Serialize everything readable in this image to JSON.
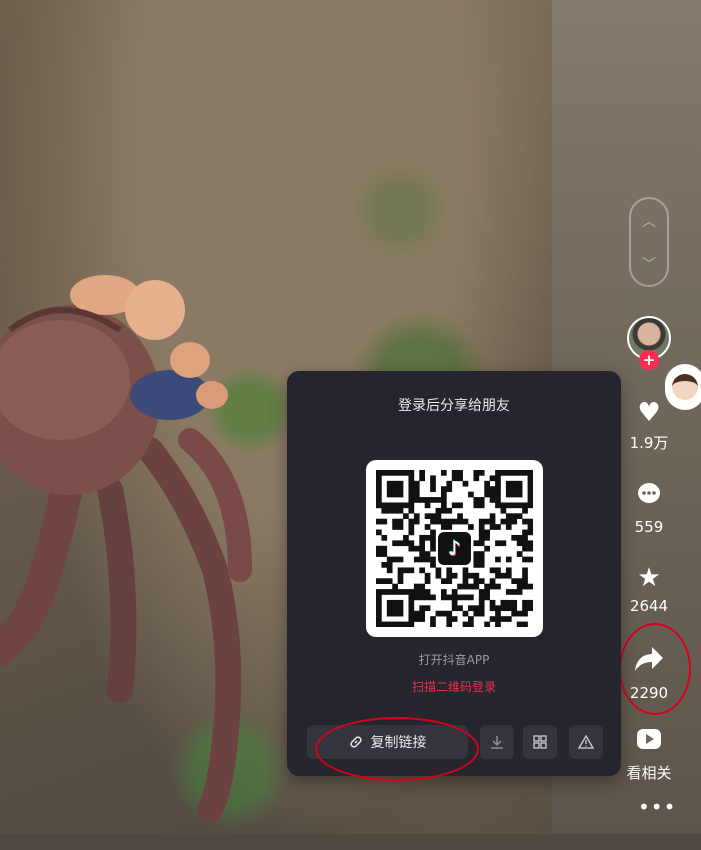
{
  "share_panel": {
    "title": "登录后分享给朋友",
    "open_app_text": "打开抖音APP",
    "scan_login_text": "扫描二维码登录",
    "copy_link_label": "复制链接",
    "qr_logo_icon": "tiktok-logo-icon",
    "actions": [
      "download-icon",
      "qr-grid-icon",
      "report-icon"
    ]
  },
  "sidebar": {
    "like_count": "1.9万",
    "comment_count": "559",
    "favorite_count": "2644",
    "share_count": "2290",
    "related_label": "看相关",
    "more_icon": "more-dots-icon"
  },
  "colors": {
    "panel_bg": "#25252d",
    "accent_red": "#e8324d",
    "follow_red": "#fe2c55",
    "annotation_red": "#d8001c"
  }
}
